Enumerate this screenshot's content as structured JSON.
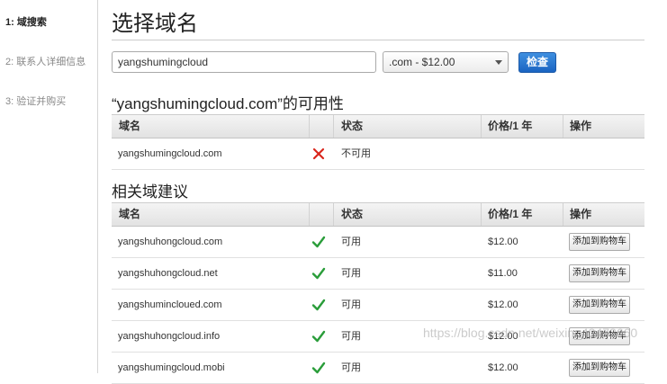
{
  "sidebar": {
    "steps": [
      {
        "label": "1: 域搜索"
      },
      {
        "label": "2: 联系人详细信息"
      },
      {
        "label": "3: 验证并购买"
      }
    ]
  },
  "main": {
    "title": "选择域名",
    "search": {
      "value": "yangshumingcloud"
    },
    "tld_select": {
      "selected": ".com - $12.00"
    },
    "check_button": "检查"
  },
  "availability": {
    "title": "“yangshumingcloud.com”的可用性",
    "headers": {
      "domain": "域名",
      "status": "状态",
      "price": "价格/1 年",
      "action": "操作"
    },
    "rows": [
      {
        "domain": "yangshumingcloud.com",
        "status_icon": "cross-icon",
        "status": "不可用"
      }
    ]
  },
  "suggestions": {
    "title": "相关域建议",
    "headers": {
      "domain": "域名",
      "status": "状态",
      "price": "价格/1 年",
      "action": "操作"
    },
    "rows": [
      {
        "domain": "yangshuhongcloud.com",
        "status_icon": "checkmark-icon",
        "status": "可用",
        "price": "$12.00",
        "action": "添加到购物车"
      },
      {
        "domain": "yangshuhongcloud.net",
        "status_icon": "checkmark-icon",
        "status": "可用",
        "price": "$11.00",
        "action": "添加到购物车"
      },
      {
        "domain": "yangshumincloued.com",
        "status_icon": "checkmark-icon",
        "status": "可用",
        "price": "$12.00",
        "action": "添加到购物车"
      },
      {
        "domain": "yangshuhongcloud.info",
        "status_icon": "checkmark-icon",
        "status": "可用",
        "price": "$12.00",
        "action": "添加到购物车"
      },
      {
        "domain": "yangshumingcloud.mobi",
        "status_icon": "checkmark-icon",
        "status": "可用",
        "price": "$12.00",
        "action": "添加到购物车"
      }
    ]
  },
  "colors": {
    "available": "#2a9d3a",
    "unavailable": "#d9261c",
    "primary_button": "#1a64c2"
  },
  "watermark": "https://blog.csdn.net/weixin_43472660"
}
